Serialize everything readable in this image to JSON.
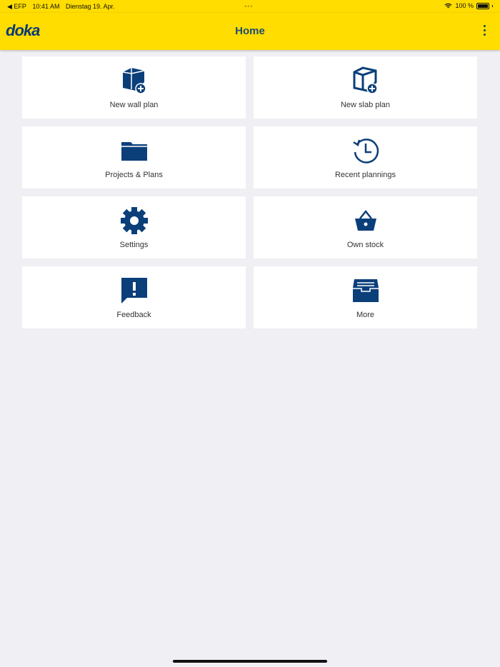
{
  "status_bar": {
    "back_app": "◀ EFP",
    "time": "10:41 AM",
    "date": "Dienstag 19. Apr.",
    "battery": "100 %"
  },
  "navbar": {
    "logo": "doka",
    "title": "Home"
  },
  "tiles": [
    {
      "label": "New wall plan",
      "icon": "wall-plan-add-icon"
    },
    {
      "label": "New slab plan",
      "icon": "slab-plan-add-icon"
    },
    {
      "label": "Projects & Plans",
      "icon": "folder-icon"
    },
    {
      "label": "Recent plannings",
      "icon": "history-icon"
    },
    {
      "label": "Settings",
      "icon": "gear-icon"
    },
    {
      "label": "Own stock",
      "icon": "basket-icon"
    },
    {
      "label": "Feedback",
      "icon": "feedback-icon"
    },
    {
      "label": "More",
      "icon": "archive-box-icon"
    }
  ],
  "colors": {
    "brand_yellow": "#ffdd00",
    "icon_blue": "#0b3f7a",
    "background": "#efeff4"
  }
}
